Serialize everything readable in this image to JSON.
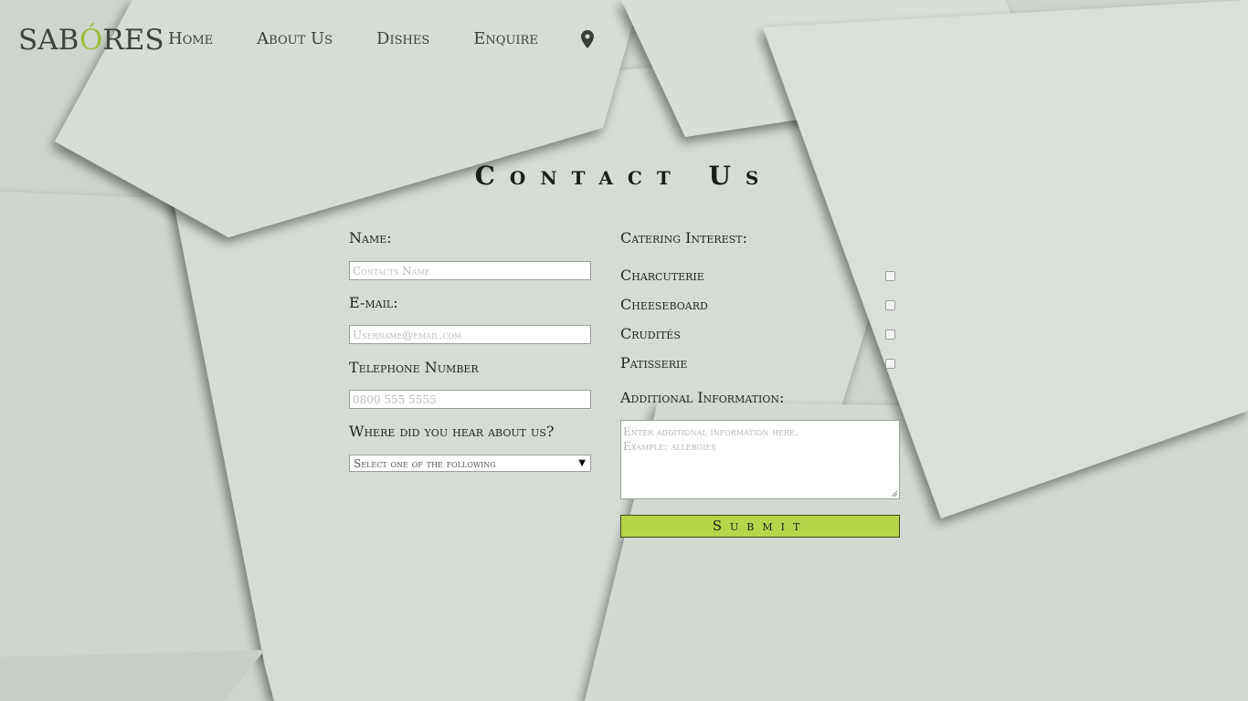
{
  "brand": {
    "logo_text_pre": "SAB",
    "logo_accent": "Ó",
    "logo_text_post": "RES",
    "accent_color": "#9bbd3c"
  },
  "nav": {
    "items": [
      {
        "label": "Home"
      },
      {
        "label": "About Us"
      },
      {
        "label": "Dishes"
      },
      {
        "label": "Enquire"
      }
    ],
    "location_icon": "map-pin-icon"
  },
  "page": {
    "title": "Contact Us"
  },
  "form": {
    "name_label": "Name:",
    "name_placeholder": "Contacts Name",
    "email_label": "E-mail:",
    "email_placeholder": "Username@email.com",
    "phone_label": "Telephone Number",
    "phone_placeholder": "0800 555 5555",
    "source_label": "Where did you hear about us?",
    "source_selected": "Select one of the following",
    "catering_label": "Catering Interest:",
    "catering_options": [
      {
        "label": "Charcuterie",
        "checked": false
      },
      {
        "label": "Cheeseboard",
        "checked": false
      },
      {
        "label": "Crudités",
        "checked": false
      },
      {
        "label": "Patisserie",
        "checked": false
      }
    ],
    "additional_label": "Additional Information:",
    "additional_placeholder_line1": "Enter additional information here.",
    "additional_placeholder_line2": "Example: allergies",
    "submit_label": "Submit",
    "submit_color": "#b7d54a"
  }
}
